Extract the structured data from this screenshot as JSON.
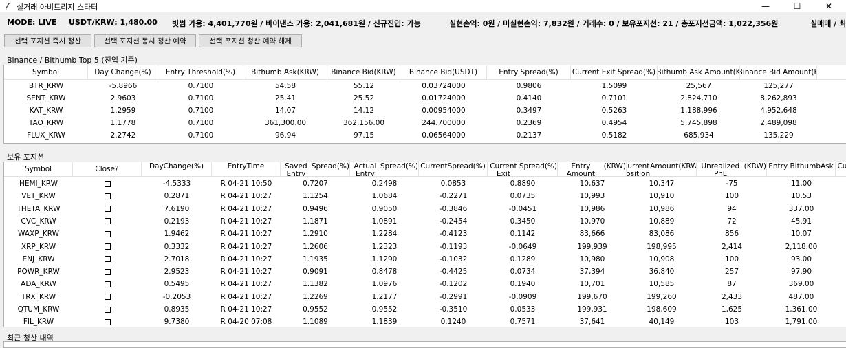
{
  "window": {
    "title": "실거래 아비트리지 스타터",
    "minimize": "—",
    "maximize": "☐",
    "close": "✕"
  },
  "status": {
    "mode": "MODE: LIVE",
    "rate": "USDT/KRW: 1,480.00",
    "balances": "빗썸 가용: 4,401,770원 / 바이낸스 가용: 2,041,681원 / 신규진입: 가능",
    "pnl": "실현손익: 0원 / 미실현손익: 7,832원 / 거래수: 0 / 보유포지션: 21 / 총포지션금액: 1,022,356원",
    "extra": "실매매 / 최"
  },
  "buttons": {
    "close_now": "선택 포지션 즉시 청산",
    "reserve_simul": "선택 포지션 동시 청산 예약",
    "cancel_reserve": "선택 포지션 청산 예약 해제"
  },
  "top5": {
    "label": "Binance / Bithumb Top 5 (진입 기준)",
    "headers": [
      "Symbol",
      "Day Change(%)",
      "Entry Threshold(%)",
      "Bithumb Ask(KRW)",
      "Binance Bid(KRW)",
      "Binance Bid(USDT)",
      "Entry Spread(%)",
      "Current Exit Spread(%)",
      "Bithumb Ask Amount(K",
      "Binance Bid Amount(K"
    ],
    "rows": [
      [
        "BTR_KRW",
        "-5.8966",
        "0.7100",
        "54.58",
        "55.12",
        "0.03724000",
        "0.9806",
        "1.5099",
        "25,567",
        "125,277"
      ],
      [
        "SENT_KRW",
        "2.9603",
        "0.7100",
        "25.41",
        "25.52",
        "0.01724000",
        "0.4140",
        "0.7101",
        "2,824,710",
        "8,262,893"
      ],
      [
        "KAT_KRW",
        "1.2959",
        "0.7100",
        "14.07",
        "14.12",
        "0.00954000",
        "0.3497",
        "0.5263",
        "1,188,996",
        "4,952,648"
      ],
      [
        "TAO_KRW",
        "1.1778",
        "0.7100",
        "361,300.00",
        "362,156.00",
        "244.700000",
        "0.2369",
        "0.4954",
        "5,745,898",
        "2,489,098"
      ],
      [
        "FLUX_KRW",
        "2.2742",
        "0.7100",
        "96.94",
        "97.15",
        "0.06564000",
        "0.2137",
        "0.5182",
        "685,934",
        "135,229"
      ]
    ]
  },
  "positions": {
    "label": "보유 포지션",
    "headers": [
      [
        "Symbol"
      ],
      [
        "Close?"
      ],
      [
        "Day",
        "Change(%)"
      ],
      [
        "Entry",
        "Time"
      ],
      [
        "Saved Entry",
        "Spread(%)"
      ],
      [
        "Actual Entry",
        "Spread(%)"
      ],
      [
        "Current",
        "Spread(%)"
      ],
      [
        "Current Exit",
        "Spread(%)"
      ],
      [
        "Entry Amount",
        "(KRW)"
      ],
      [
        "Current Position",
        "Amount(KRW)"
      ],
      [
        "Unrealized PnL",
        "(KRW)"
      ],
      [
        "Entry Bithumb",
        "Ask"
      ],
      [
        "Cu",
        "Bi"
      ]
    ],
    "rows": [
      [
        "HEMI_KRW",
        "",
        "-4.5333",
        "R 04-21 10:50",
        "0.7207",
        "0.2498",
        "0.0853",
        "0.8890",
        "10,637",
        "10,347",
        "-75",
        "11.00"
      ],
      [
        "VET_KRW",
        "",
        "0.2871",
        "R 04-21 10:27",
        "1.1254",
        "1.0684",
        "-0.2271",
        "0.0735",
        "10,993",
        "10,910",
        "100",
        "10.53"
      ],
      [
        "THETA_KRW",
        "",
        "7.6190",
        "R 04-21 10:27",
        "0.9496",
        "0.9050",
        "-0.3846",
        "-0.0451",
        "10,986",
        "10,986",
        "94",
        "337.00"
      ],
      [
        "CVC_KRW",
        "",
        "0.2193",
        "R 04-21 10:27",
        "1.1871",
        "1.0891",
        "-0.2454",
        "0.3450",
        "10,970",
        "10,889",
        "72",
        "45.91"
      ],
      [
        "WAXP_KRW",
        "",
        "1.9462",
        "R 04-21 10:27",
        "1.2910",
        "1.2284",
        "-0.4123",
        "0.1142",
        "83,666",
        "83,086",
        "856",
        "10.07"
      ],
      [
        "XRP_KRW",
        "",
        "0.3332",
        "R 04-21 10:27",
        "1.2606",
        "1.2323",
        "-0.1193",
        "-0.0649",
        "199,939",
        "198,995",
        "2,414",
        "2,118.00"
      ],
      [
        "ENJ_KRW",
        "",
        "2.7018",
        "R 04-21 10:27",
        "1.1935",
        "1.1290",
        "-0.1032",
        "0.1289",
        "10,980",
        "10,908",
        "100",
        "93.00"
      ],
      [
        "POWR_KRW",
        "",
        "2.9523",
        "R 04-21 10:27",
        "0.9091",
        "0.8478",
        "-0.4425",
        "0.0734",
        "37,394",
        "36,840",
        "257",
        "97.90"
      ],
      [
        "ADA_KRW",
        "",
        "0.5495",
        "R 04-21 10:27",
        "1.1382",
        "1.0976",
        "-0.1202",
        "0.1940",
        "10,701",
        "10,585",
        "87",
        "369.00"
      ],
      [
        "TRX_KRW",
        "",
        "-0.2053",
        "R 04-21 10:27",
        "1.2269",
        "1.2177",
        "-0.2991",
        "-0.0909",
        "199,670",
        "199,260",
        "2,433",
        "487.00"
      ],
      [
        "QTUM_KRW",
        "",
        "0.8935",
        "R 04-21 10:27",
        "0.9552",
        "0.9552",
        "-0.3510",
        "0.0533",
        "199,931",
        "198,609",
        "1,625",
        "1,361.00"
      ],
      [
        "FIL_KRW",
        "",
        "9.7380",
        "R 04-20 07:08",
        "1.1089",
        "1.1839",
        "0.1240",
        "0.7571",
        "37,641",
        "40,149",
        "103",
        "1,791.00"
      ]
    ]
  },
  "history": {
    "label": "최근 청산 내역"
  },
  "icons": {
    "app": "feather-icon"
  }
}
